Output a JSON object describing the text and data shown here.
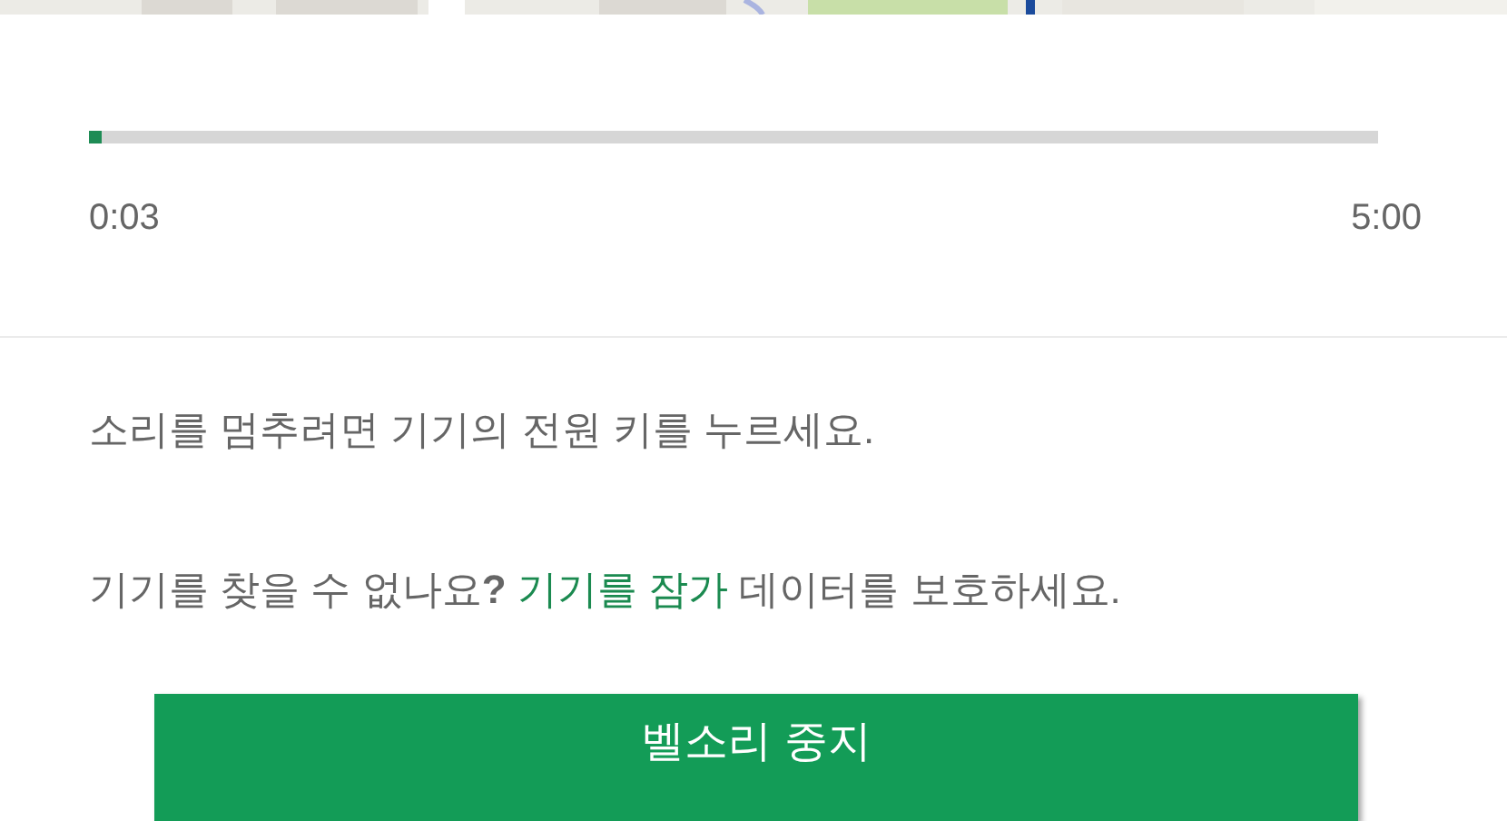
{
  "progress": {
    "level": 0.01,
    "elapsed": "0:03",
    "total": "5:00"
  },
  "message": "소리를 멈추려면 기기의 전원 키를 누르세요.",
  "lock_prompt": {
    "before": "기기를 찾을 수 없나요**?**",
    "link": "기기를 잠가",
    "after": "데이터를 보호하세요."
  },
  "button": "벨소리 중지"
}
